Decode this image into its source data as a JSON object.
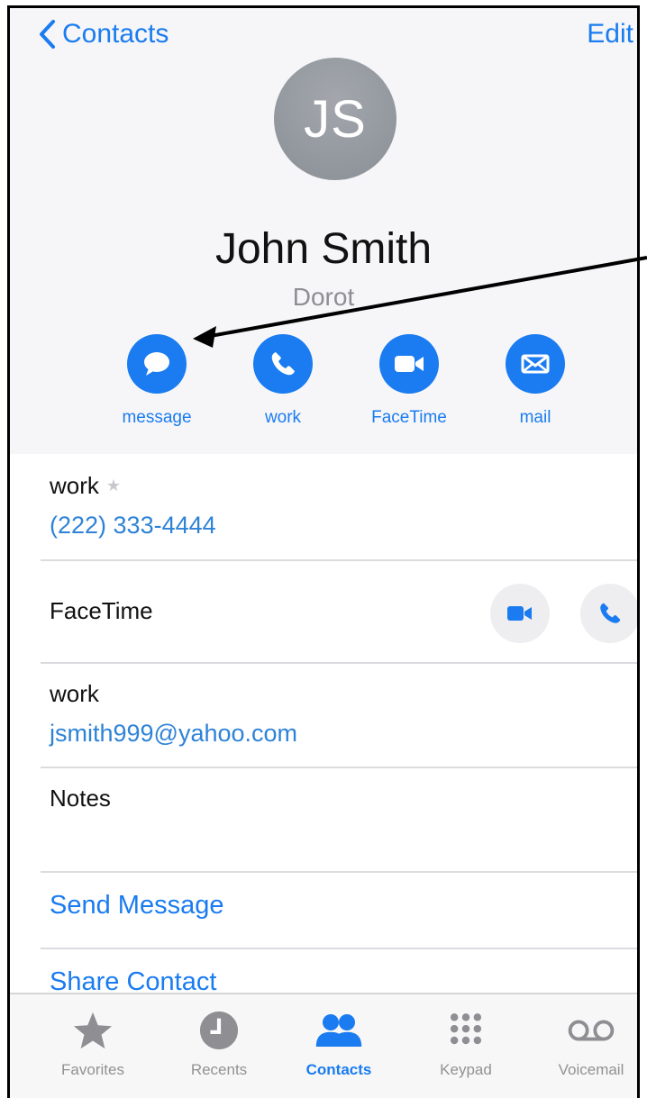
{
  "nav": {
    "back_label": "Contacts",
    "edit_label": "Edit"
  },
  "contact": {
    "initials": "JS",
    "name": "John Smith",
    "company": "Dorot"
  },
  "actions": [
    {
      "label": "message",
      "icon": "message-icon"
    },
    {
      "label": "work",
      "icon": "phone-icon"
    },
    {
      "label": "FaceTime",
      "icon": "video-icon"
    },
    {
      "label": "mail",
      "icon": "mail-icon"
    }
  ],
  "phone": {
    "label": "work",
    "value": "(222) 333-4444",
    "favorite_icon": "star-icon"
  },
  "facetime": {
    "label": "FaceTime"
  },
  "email": {
    "label": "work",
    "value": "jsmith999@yahoo.com"
  },
  "notes": {
    "label": "Notes"
  },
  "links": {
    "send_message": "Send Message",
    "share_contact": "Share Contact"
  },
  "tabbar": [
    {
      "label": "Favorites",
      "icon": "star-icon",
      "active": false
    },
    {
      "label": "Recents",
      "icon": "clock-icon",
      "active": false
    },
    {
      "label": "Contacts",
      "icon": "contacts-icon",
      "active": true
    },
    {
      "label": "Keypad",
      "icon": "keypad-icon",
      "active": false
    },
    {
      "label": "Voicemail",
      "icon": "voicemail-icon",
      "active": false
    }
  ],
  "colors": {
    "accent": "#1a7cf0",
    "link": "#2f83d6",
    "avatar": "#8e9399",
    "secondary_text": "#8e8e93"
  }
}
